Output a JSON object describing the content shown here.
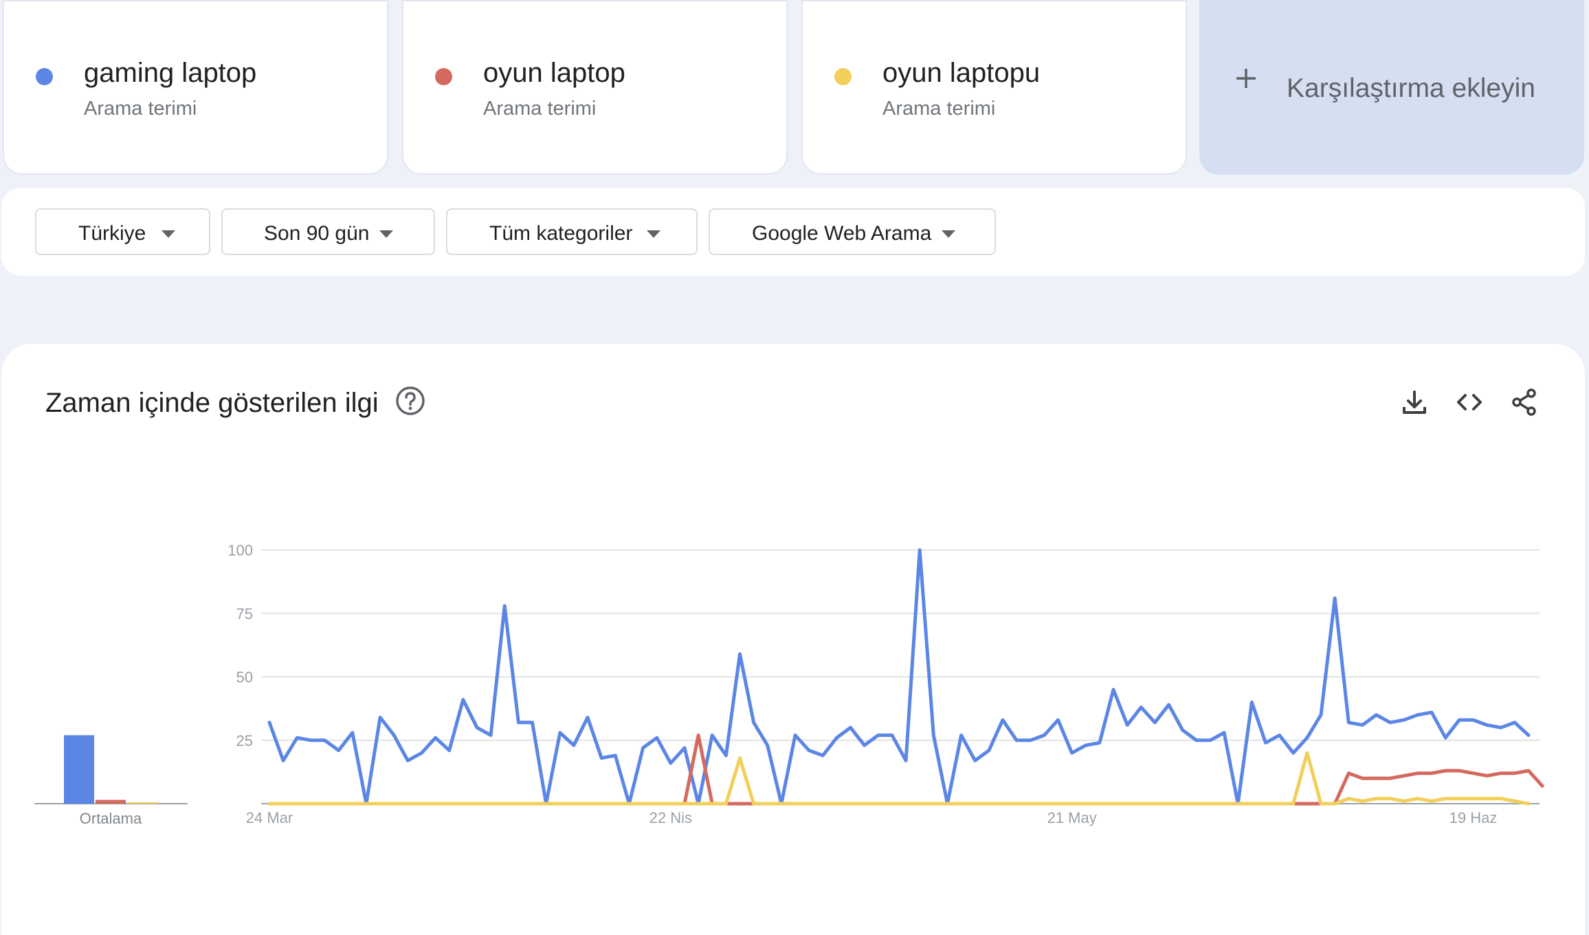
{
  "terms": [
    {
      "name": "gaming laptop",
      "subtitle": "Arama terimi",
      "color": "#5b86e5"
    },
    {
      "name": "oyun laptop",
      "subtitle": "Arama terimi",
      "color": "#d4695f"
    },
    {
      "name": "oyun laptopu",
      "subtitle": "Arama terimi",
      "color": "#f2cf5b"
    }
  ],
  "add_compare": {
    "label": "Karşılaştırma ekleyin",
    "icon": "plus-icon"
  },
  "filters": [
    {
      "label": "Türkiye",
      "icon": "caret-down-icon"
    },
    {
      "label": "Son 90 gün",
      "icon": "caret-down-icon"
    },
    {
      "label": "Tüm kategoriler",
      "icon": "caret-down-icon"
    },
    {
      "label": "Google Web Arama",
      "icon": "caret-down-icon"
    }
  ],
  "panel": {
    "title": "Zaman içinde gösterilen ilgi",
    "icons": [
      "help-icon",
      "download-icon",
      "embed-code-icon",
      "share-icon"
    ]
  },
  "chart_data": [
    {
      "type": "line",
      "title": "",
      "x_tick_labels": [
        "24 Mar",
        "22 Nis",
        "21 May",
        "19 Haz"
      ],
      "y_ticks": [
        25,
        50,
        75,
        100
      ],
      "ylim": [
        0,
        100
      ],
      "grid": true,
      "series": [
        {
          "name": "gaming laptop",
          "color": "#5b86e5",
          "values": [
            32,
            17,
            26,
            25,
            25,
            21,
            28,
            0,
            34,
            27,
            17,
            20,
            26,
            21,
            41,
            30,
            27,
            78,
            32,
            32,
            0,
            28,
            23,
            34,
            18,
            19,
            0,
            22,
            26,
            16,
            22,
            0,
            27,
            19,
            59,
            32,
            23,
            0,
            27,
            21,
            19,
            26,
            30,
            23,
            27,
            27,
            17,
            100,
            27,
            0,
            27,
            17,
            21,
            33,
            25,
            25,
            27,
            33,
            20,
            23,
            24,
            45,
            31,
            38,
            32,
            39,
            29,
            25,
            25,
            28,
            0,
            40,
            24,
            27,
            20,
            26,
            35,
            81,
            32,
            31,
            35,
            32,
            33,
            35,
            36,
            26,
            33,
            33,
            31,
            30,
            32,
            27
          ]
        },
        {
          "name": "oyun laptop",
          "color": "#d4695f",
          "values": [
            0,
            0,
            0,
            0,
            0,
            0,
            0,
            0,
            0,
            0,
            0,
            0,
            0,
            0,
            0,
            0,
            0,
            0,
            0,
            0,
            0,
            0,
            0,
            0,
            0,
            0,
            0,
            0,
            0,
            0,
            0,
            27,
            0,
            0,
            0,
            0,
            0,
            0,
            0,
            0,
            0,
            0,
            0,
            0,
            0,
            0,
            0,
            0,
            0,
            0,
            0,
            0,
            0,
            0,
            0,
            0,
            0,
            0,
            0,
            0,
            0,
            0,
            0,
            0,
            0,
            0,
            0,
            0,
            0,
            0,
            0,
            0,
            0,
            0,
            0,
            0,
            0,
            0,
            12,
            10,
            10,
            10,
            11,
            12,
            12,
            13,
            13,
            12,
            11,
            12,
            12,
            13,
            7
          ]
        },
        {
          "name": "oyun laptopu",
          "color": "#f2cf5b",
          "values": [
            0,
            0,
            0,
            0,
            0,
            0,
            0,
            0,
            0,
            0,
            0,
            0,
            0,
            0,
            0,
            0,
            0,
            0,
            0,
            0,
            0,
            0,
            0,
            0,
            0,
            0,
            0,
            0,
            0,
            0,
            0,
            0,
            0,
            0,
            18,
            0,
            0,
            0,
            0,
            0,
            0,
            0,
            0,
            0,
            0,
            0,
            0,
            0,
            0,
            0,
            0,
            0,
            0,
            0,
            0,
            0,
            0,
            0,
            0,
            0,
            0,
            0,
            0,
            0,
            0,
            0,
            0,
            0,
            0,
            0,
            0,
            0,
            0,
            0,
            0,
            20,
            0,
            0,
            2,
            1,
            2,
            2,
            1,
            2,
            1,
            2,
            2,
            2,
            2,
            2,
            1,
            0
          ]
        }
      ]
    },
    {
      "type": "bar",
      "categories": [
        "Ortalama"
      ],
      "series": [
        {
          "name": "gaming laptop",
          "values": [
            27
          ]
        },
        {
          "name": "oyun laptop",
          "values": [
            1.5
          ]
        },
        {
          "name": "oyun laptopu",
          "values": [
            0.5
          ]
        }
      ],
      "ylim": [
        0,
        100
      ]
    }
  ]
}
